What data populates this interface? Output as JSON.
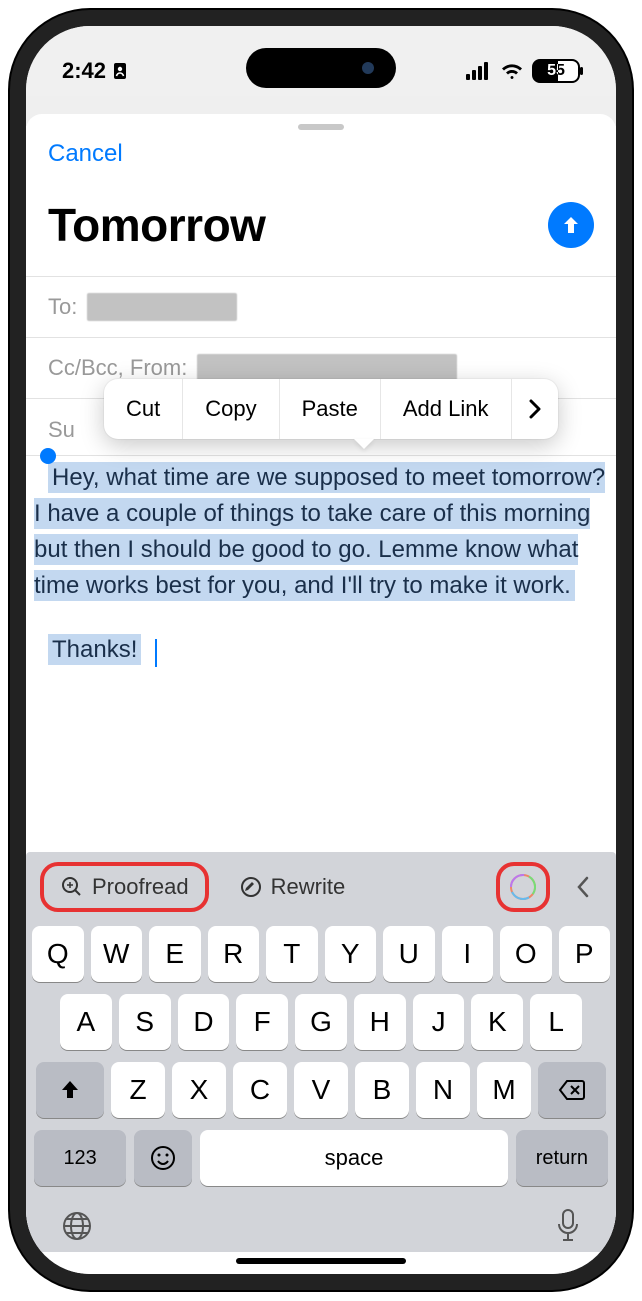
{
  "statusbar": {
    "time": "2:42",
    "battery": "55"
  },
  "header": {
    "cancel": "Cancel"
  },
  "compose": {
    "title": "Tomorrow",
    "to_label": "To:",
    "ccbcc_label": "Cc/Bcc, From:",
    "subject_label": "Su",
    "body": "Hey, what time are we supposed to meet tomorrow? I have a couple of things to take care of this morning but then I should be good to go. Lemme know what time works best for you, and I'll try to make it work.",
    "thanks": "Thanks!"
  },
  "context_menu": {
    "items": [
      "Cut",
      "Copy",
      "Paste",
      "Add Link"
    ]
  },
  "writing_tools": {
    "proofread": "Proofread",
    "rewrite": "Rewrite"
  },
  "keyboard": {
    "row1": [
      "Q",
      "W",
      "E",
      "R",
      "T",
      "Y",
      "U",
      "I",
      "O",
      "P"
    ],
    "row2": [
      "A",
      "S",
      "D",
      "F",
      "G",
      "H",
      "J",
      "K",
      "L"
    ],
    "row3": [
      "Z",
      "X",
      "C",
      "V",
      "B",
      "N",
      "M"
    ],
    "numbers": "123",
    "space": "space",
    "return": "return"
  }
}
